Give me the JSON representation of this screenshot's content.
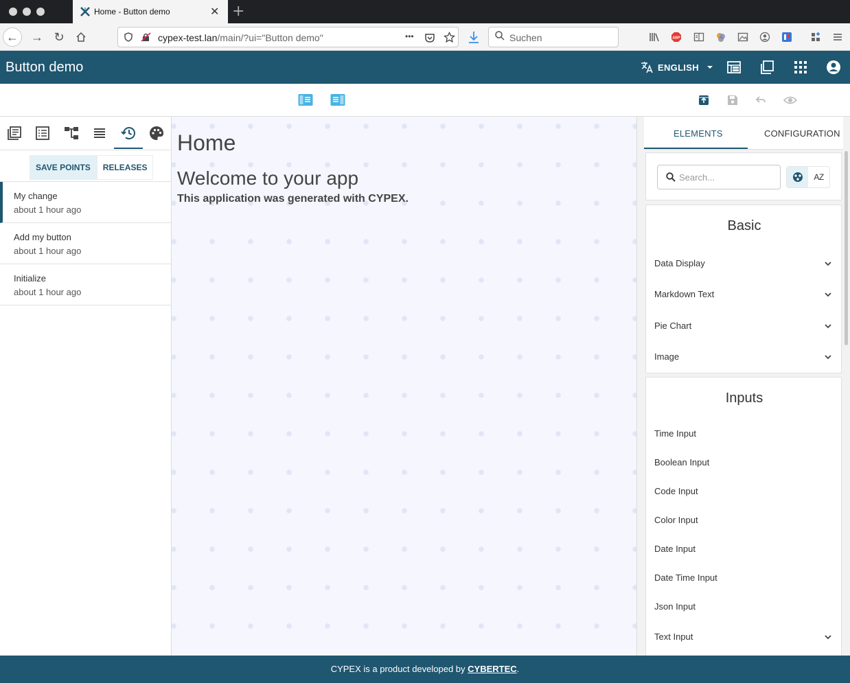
{
  "browser": {
    "tab_title": "Home - Button demo",
    "new_tab_glyph": "+",
    "close_glyph": "✕",
    "url_host": "cypex-test.lan",
    "url_path": "/main/?ui=\"Button demo\"",
    "search_placeholder": "Suchen",
    "more_glyph": "•••"
  },
  "app": {
    "title": "Button demo",
    "language": "ENGLISH"
  },
  "left_panel": {
    "segments": [
      "SAVE POINTS",
      "RELEASES"
    ],
    "history": [
      {
        "title": "My change",
        "time": "about 1 hour ago"
      },
      {
        "title": "Add my button",
        "time": "about 1 hour ago"
      },
      {
        "title": "Initialize",
        "time": "about 1 hour ago"
      }
    ]
  },
  "canvas": {
    "page_title": "Home",
    "welcome": "Welcome to your app",
    "generated_prefix": "This application was generated with ",
    "generated_brand": "CYPEX",
    "generated_suffix": "."
  },
  "right_panel": {
    "tabs": [
      "ELEMENTS",
      "CONFIGURATION"
    ],
    "search_placeholder": "Search...",
    "sort_alpha_label": "AZ",
    "groups": [
      {
        "title": "Basic",
        "items": [
          "Data Display",
          "Markdown Text",
          "Pie Chart",
          "Image"
        ]
      },
      {
        "title": "Inputs",
        "items": [
          "Time Input",
          "Boolean Input",
          "Code Input",
          "Color Input",
          "Date Input",
          "Date Time Input",
          "Json Input",
          "Text Input"
        ]
      }
    ]
  },
  "footer": {
    "text": "CYPEX is a product developed by ",
    "link": "CYBERTEC",
    "suffix": "."
  },
  "colors": {
    "primary": "#1f5670",
    "accent_light": "#e3f1f6",
    "canvas_bg": "#f5f6fe",
    "toolbar_icon": "#4ab3e2"
  }
}
